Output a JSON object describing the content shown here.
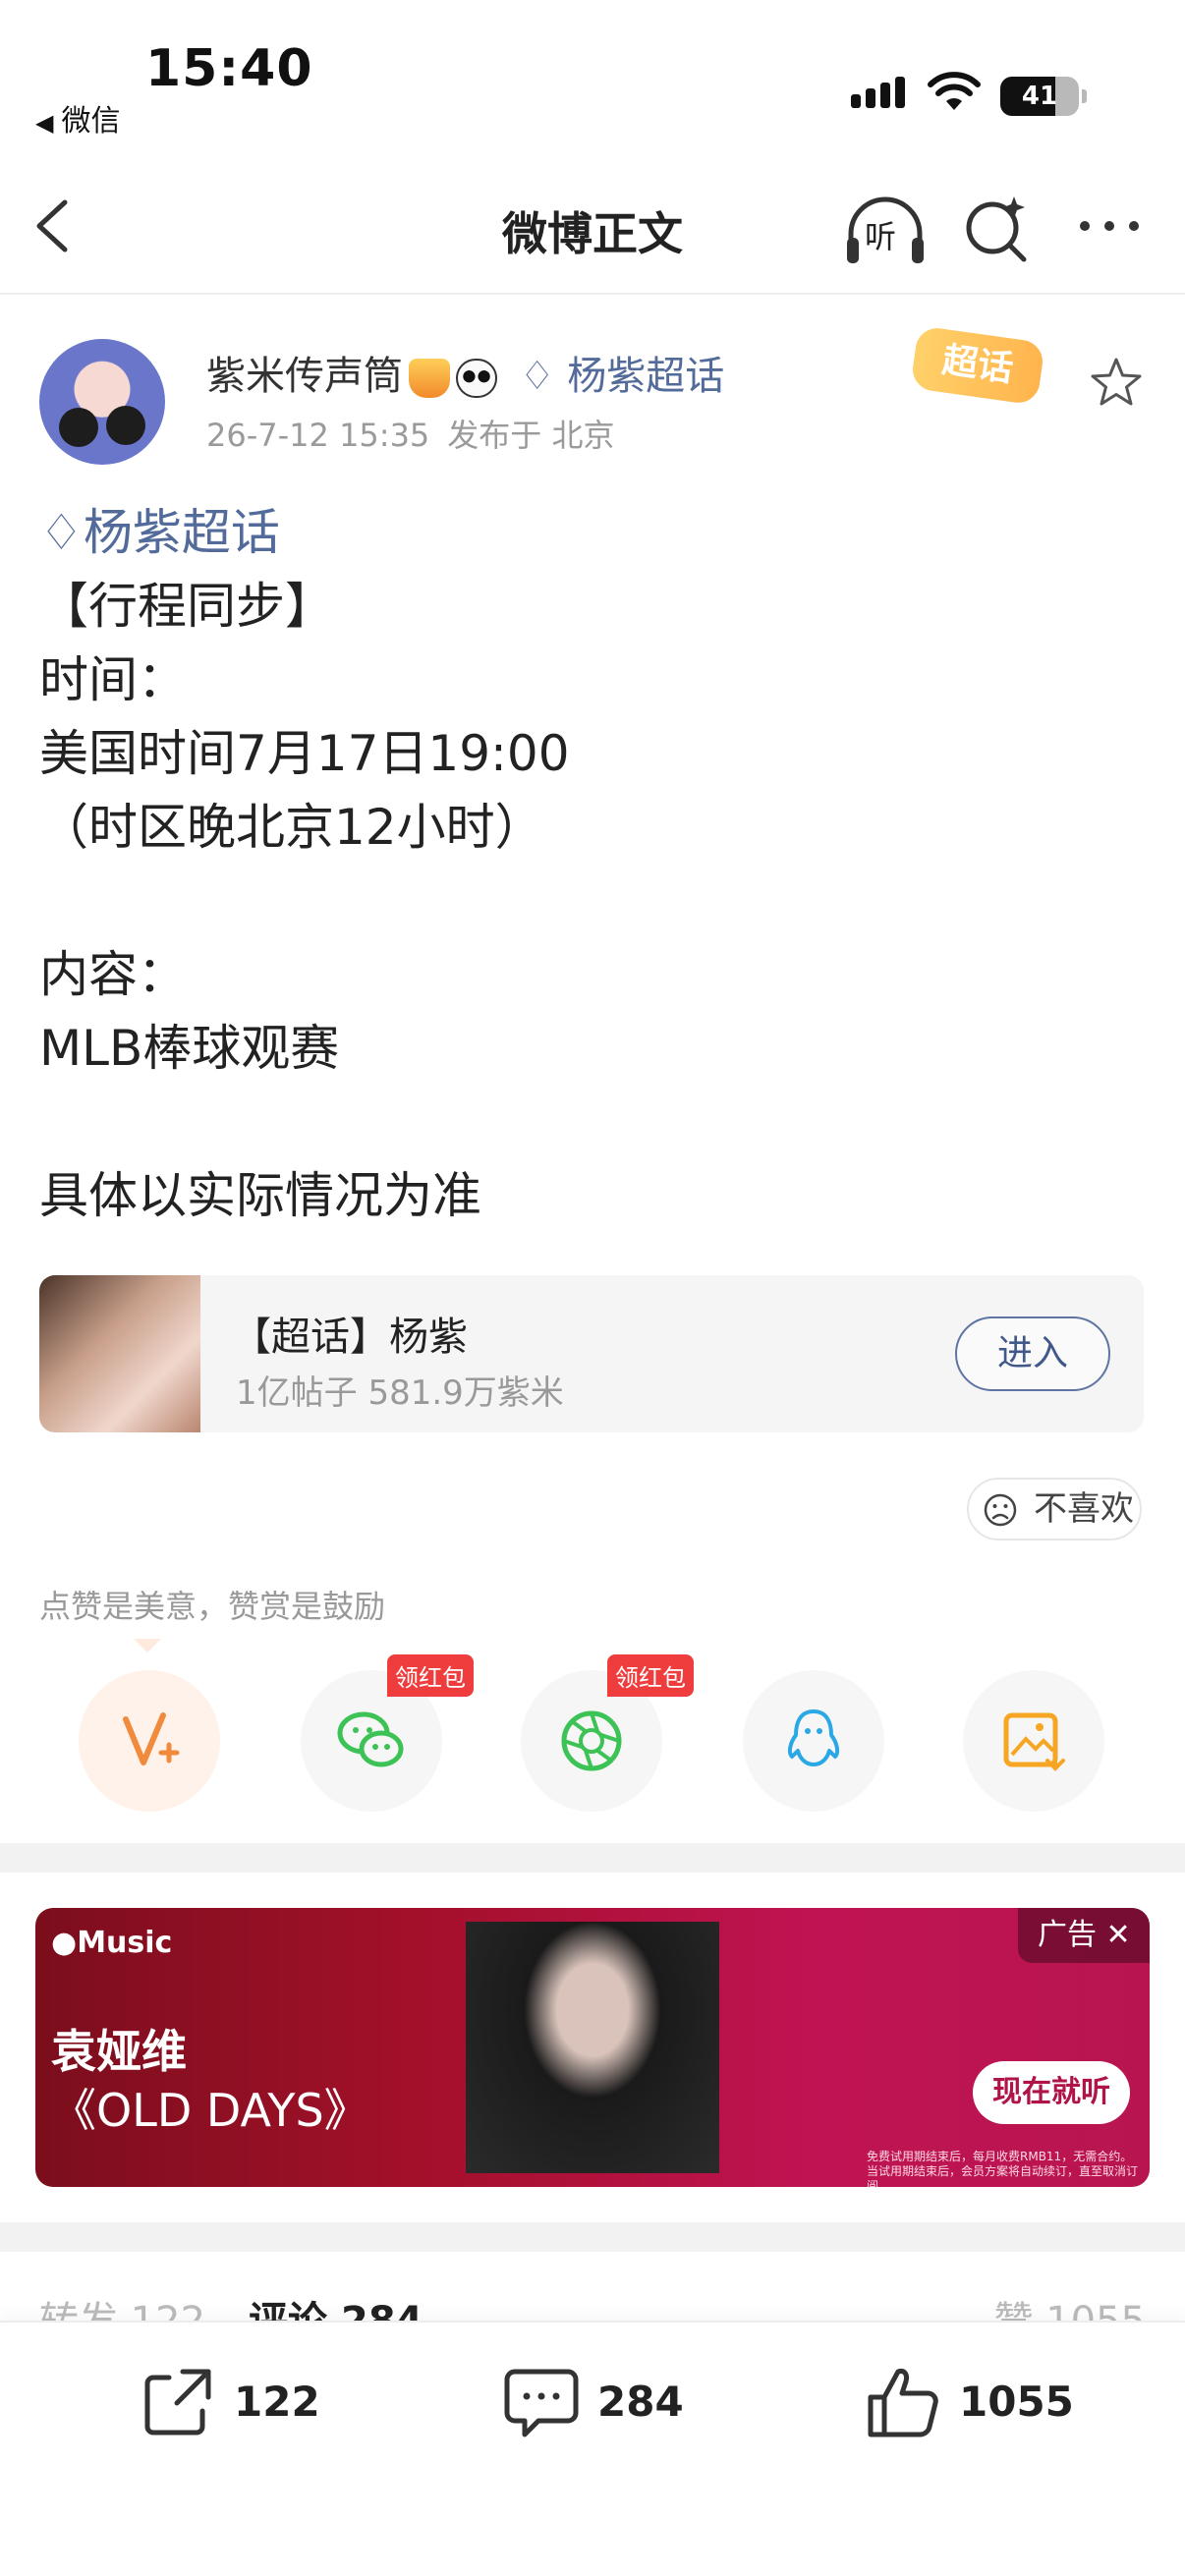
{
  "status_bar": {
    "time": "15:40",
    "back_app": "微信",
    "battery": "41"
  },
  "nav": {
    "title": "微博正文",
    "listen_label": "听"
  },
  "post": {
    "author": "紫米传声筒",
    "author_topic": "杨紫超话",
    "date": "26-7-12 15:35",
    "location": "发布于 北京",
    "sticker": "超话",
    "content": {
      "topic": "杨紫超话",
      "lines": [
        "【行程同步】",
        "时间：",
        "美国时间7月17日19:00",
        "（时区晚北京12小时）",
        "",
        "内容：",
        "MLB棒球观赛",
        "",
        "具体以实际情况为准"
      ]
    }
  },
  "topic_card": {
    "title": "【超话】杨紫",
    "stats": "1亿帖子 581.9万紫米",
    "button": "进入"
  },
  "dislike_label": "不喜欢",
  "reward_tip": "点赞是美意，赞赏是鼓励",
  "share": {
    "redpacket_tag": "领红包",
    "buttons": [
      "reward",
      "wechat",
      "moments",
      "qq",
      "save-image"
    ]
  },
  "ad": {
    "brand": "Music",
    "singer": "袁娅维",
    "song": "《OLD DAYS》",
    "tag": "广告",
    "cta": "现在就听",
    "fine_print": "免费试用期结束后，每月收费RMB11，无需合约。当试用期结束后，会员方案将自动续订，直至取消订阅"
  },
  "tabs": {
    "reposts": "转发 122",
    "comments": "评论 284",
    "likes": "赞 1055"
  },
  "bottom_bar": {
    "repost_count": "122",
    "comment_count": "284",
    "like_count": "1055"
  },
  "colors": {
    "link": "#536b9a",
    "redpacket": "#ef3d3d",
    "reward": "#f08a3c",
    "wechat": "#3cc255",
    "qq": "#2aa8e6",
    "save": "#f6a623"
  }
}
